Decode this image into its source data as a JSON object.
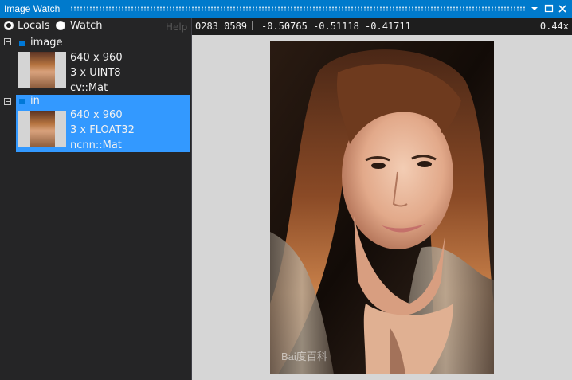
{
  "window": {
    "title": "Image Watch"
  },
  "radio": {
    "locals_label": "Locals",
    "watch_label": "Watch",
    "selected": "Locals"
  },
  "help_label": "Help",
  "toolbar": {
    "coords": "0283 0589",
    "pixel_values": "-0.50765 -0.51118 -0.41711",
    "zoom": "0.44x"
  },
  "items": [
    {
      "name": "image",
      "size": "640 x 960",
      "type": "3 x UINT8",
      "class": "cv::Mat",
      "selected": false
    },
    {
      "name": "in",
      "size": "640 x 960",
      "type": "3 x FLOAT32",
      "class": "ncnn::Mat",
      "selected": true
    }
  ],
  "viewer": {
    "watermark": "Bai度百科"
  },
  "colors": {
    "titlebar": "#007acc",
    "panel_bg": "#252526",
    "selection": "#3399ff",
    "viewer_bg": "#d6d6d6"
  },
  "icons": [
    "collapse-icon",
    "dropdown-icon",
    "maximize-icon",
    "close-icon"
  ]
}
